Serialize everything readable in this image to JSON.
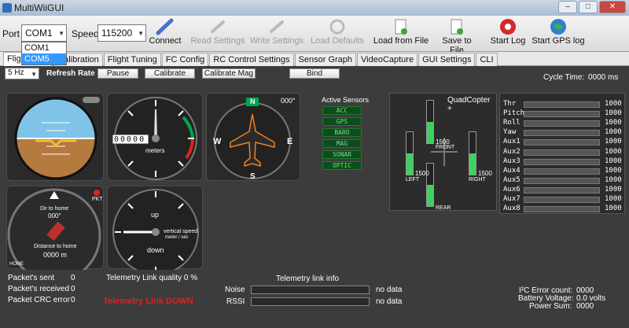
{
  "window": {
    "title": "MultiWiiGUI"
  },
  "toolbar": {
    "port_label": "Port",
    "port_value": "COM1",
    "speed_label": "Speed",
    "speed_value": "115200",
    "connect": "Connect",
    "read": "Read Settings",
    "write": "Write Settings",
    "load_defaults": "Load Defaults",
    "load_file": "Load from File",
    "save_file": "Save to File",
    "start_log": "Start Log",
    "start_gps": "Start GPS log"
  },
  "port_dropdown": {
    "options": [
      "COM1",
      "COM5"
    ],
    "selected": "COM5"
  },
  "tabs": [
    "Flight Data",
    "Calibration",
    "Flight Tuning",
    "FC Config",
    "RC Control Settings",
    "Sensor Graph",
    "VideoCapture",
    "GUI Settings",
    "CLI"
  ],
  "controls": {
    "rate": "5 Hz",
    "refresh_label": "Refresh Rate",
    "pause": "Pause",
    "calibrate": "Calibrate",
    "calibrate_mag": "Calibrate Mag",
    "bind": "Bind",
    "cycle_label": "Cycle Time:",
    "cycle_value": "0000 ms"
  },
  "gauges": {
    "heading": "000°",
    "altimeter_unit": "meters",
    "altimeter_digits": "00000",
    "dir_home": "Dir to home",
    "dir_home_val": "000°",
    "dist_home": "Distance to home",
    "dist_home_val": "0000 m",
    "home": "HOME",
    "pkt": "PKT",
    "vs_up": "up",
    "vs_down": "down",
    "vs_label": "vertical speed",
    "vs_unit": "meter / sec"
  },
  "sensors": {
    "title": "Active Sensors",
    "items": [
      "ACC",
      "GPS",
      "BARO",
      "MAG",
      "SONAR",
      "OPTIC"
    ]
  },
  "quad": {
    "title": "QuadCopter +",
    "front": "FRONT",
    "left": "LEFT",
    "right": "RIGHT",
    "rear": "REAR",
    "motor_value": "1500",
    "motor_level": 0.5
  },
  "rc": {
    "channels": [
      "Thr",
      "Pitch",
      "Roll",
      "Yaw",
      "Aux1",
      "Aux2",
      "Aux3",
      "Aux4",
      "Aux5",
      "Aux6",
      "Aux7",
      "Aux8"
    ],
    "value": "1000"
  },
  "stats": {
    "sent_label": "Packet's sent",
    "sent": "0",
    "recv_label": "Packet's received",
    "recv": "0",
    "crc_label": "Packet CRC error",
    "crc": "0",
    "link_quality": "Telemetry Link quality 0 %",
    "link_down": "Telemetry Link DOWN",
    "link_info": "Telemetry link info",
    "noise": "Noise",
    "rssi": "RSSI",
    "nodata": "no data",
    "i2c_label": "I²C Error count:",
    "i2c": "0000",
    "batt_label": "Battery Voltage:",
    "batt": "0.0 volts",
    "power_label": "Power Sum:",
    "power": "0000"
  },
  "colors": {
    "accent": "#00a651",
    "sky": "#7fc4e8",
    "ground": "#b57a3e",
    "alert": "#e02020"
  }
}
